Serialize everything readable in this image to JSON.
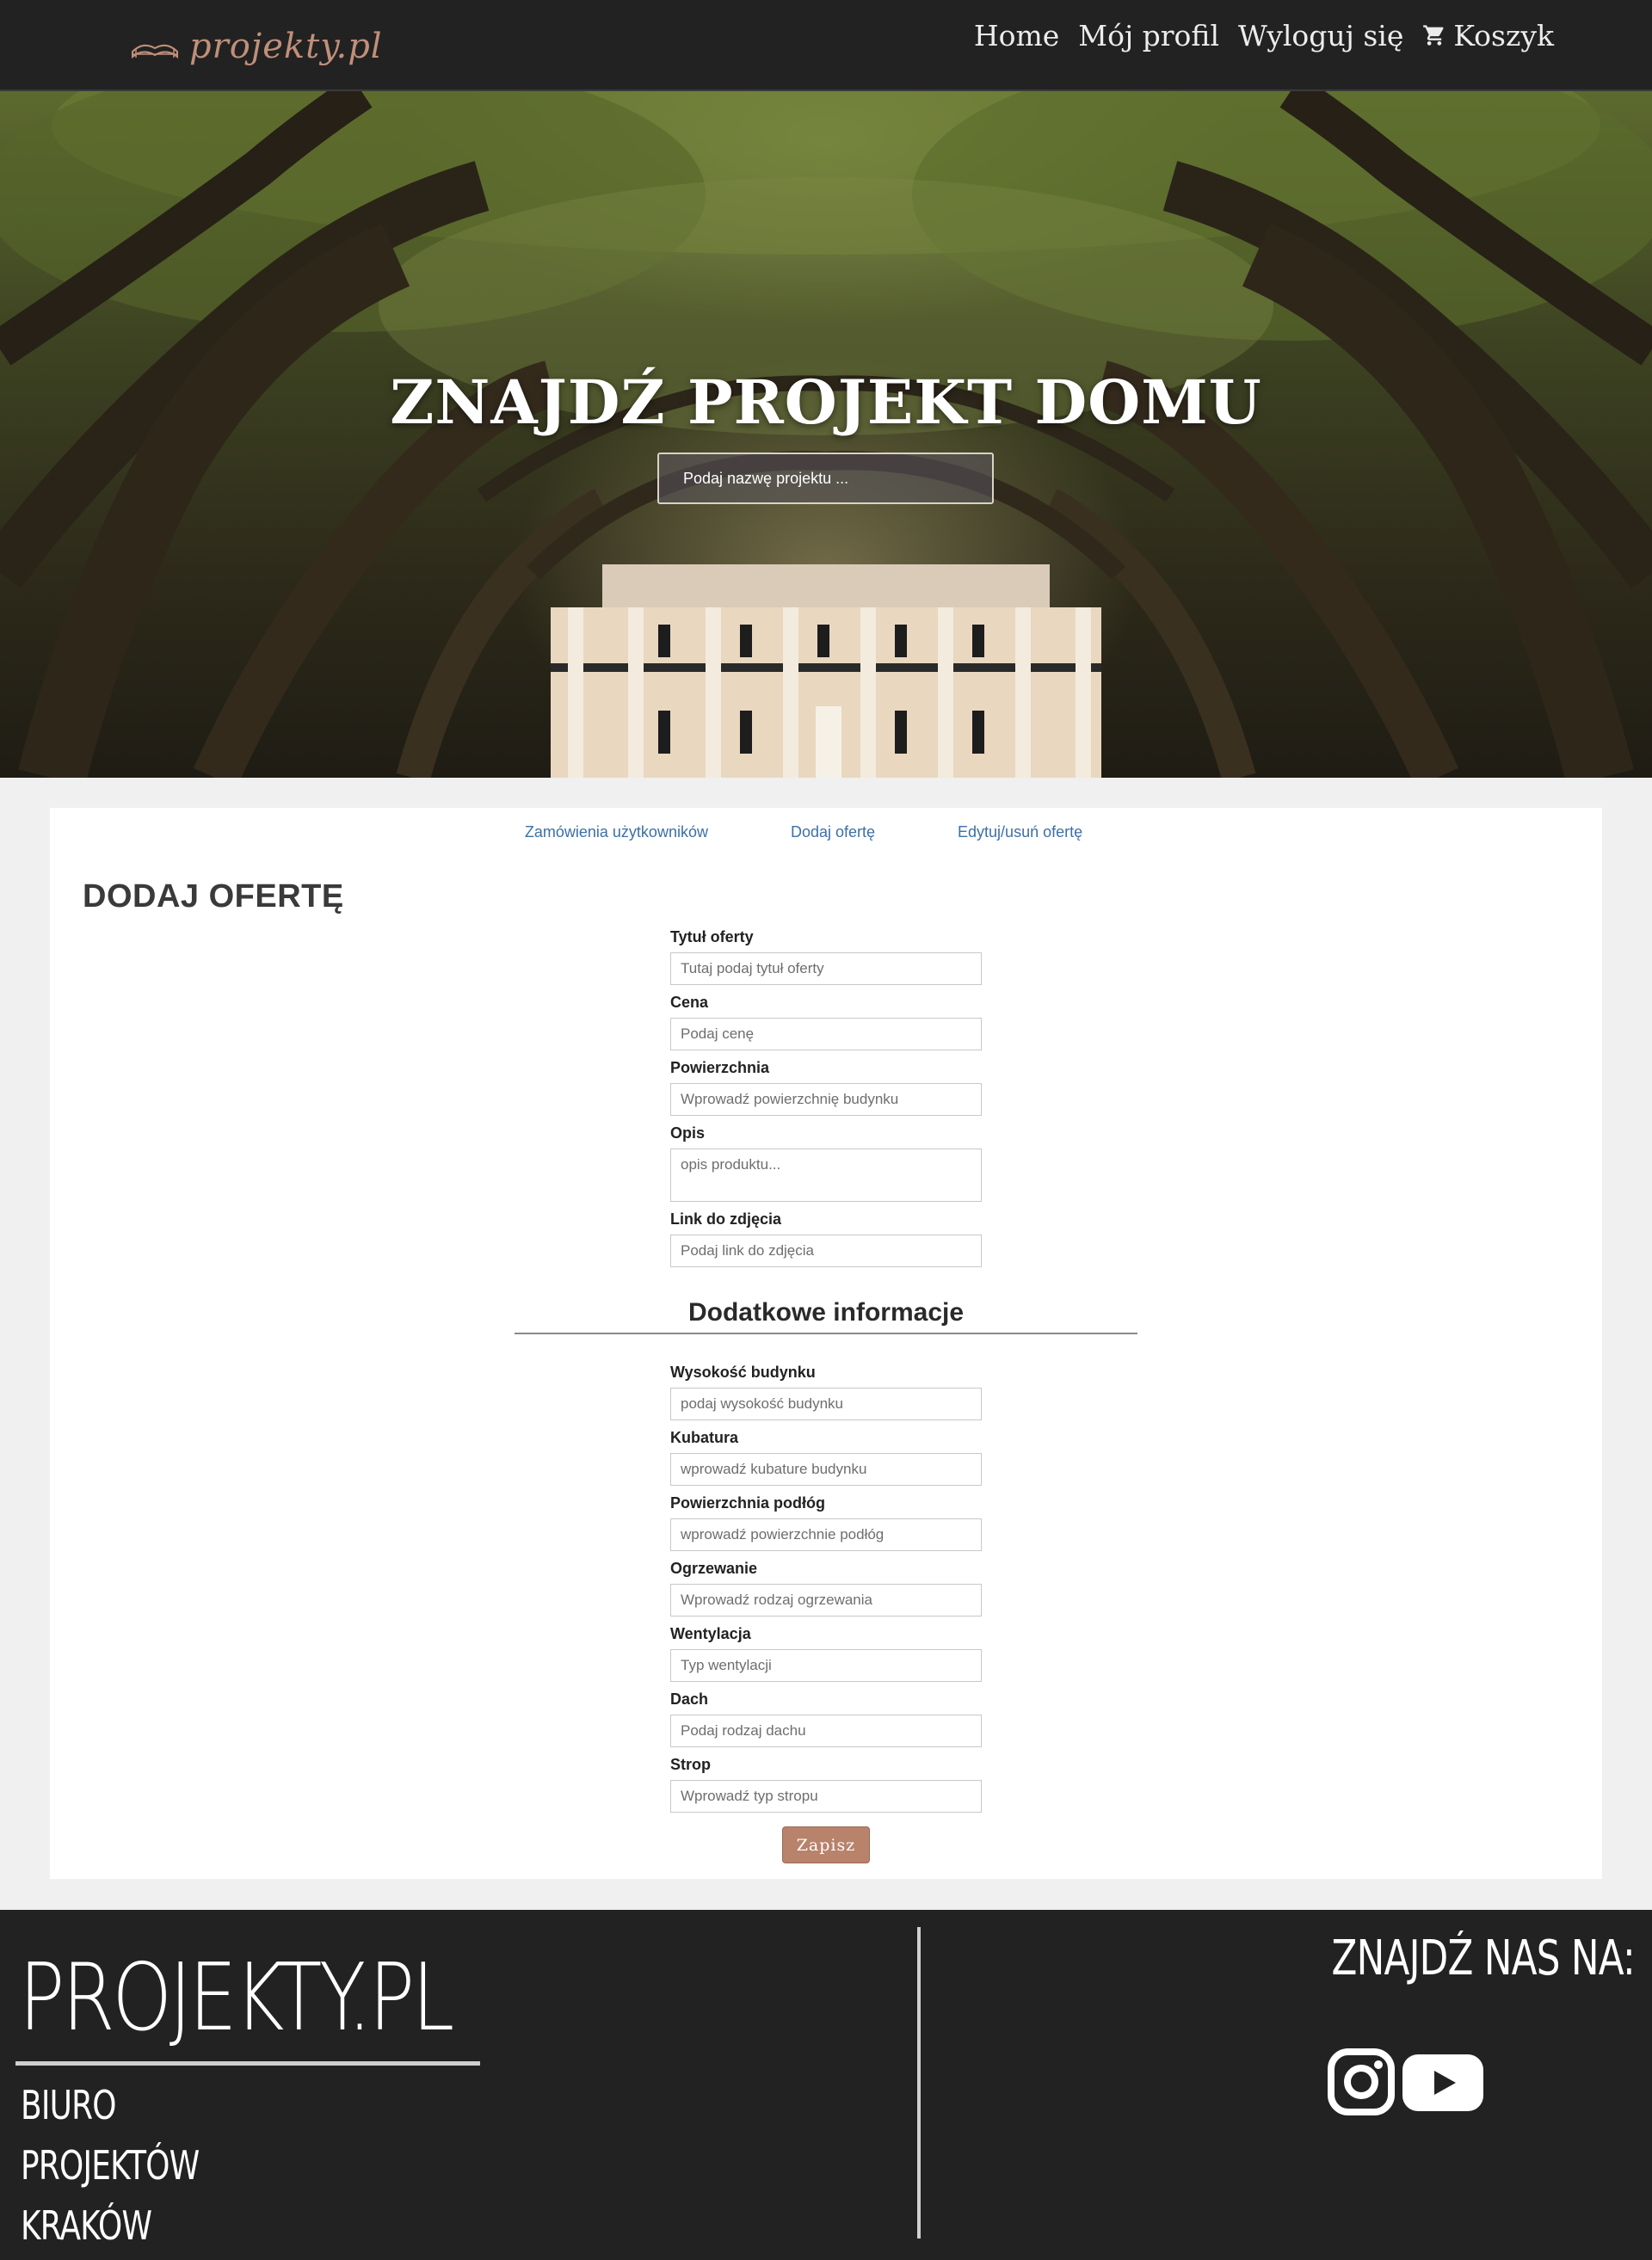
{
  "navbar": {
    "logo_text": "projekty.pl",
    "links": [
      {
        "label": "Home"
      },
      {
        "label": "Mój profil"
      },
      {
        "label": "Wyloguj się"
      },
      {
        "label": "Koszyk",
        "icon": "cart-icon"
      }
    ]
  },
  "hero": {
    "title": "ZNAJDŹ PROJEKT DOMU",
    "search_placeholder": "Podaj nazwę projektu ..."
  },
  "tabs": [
    {
      "label": "Zamówienia użytkowników"
    },
    {
      "label": "Dodaj ofertę"
    },
    {
      "label": "Edytuj/usuń ofertę"
    }
  ],
  "section_title": "DODAJ OFERTĘ",
  "form_main": [
    {
      "label": "Tytuł oferty",
      "placeholder": "Tutaj podaj tytuł oferty"
    },
    {
      "label": "Cena",
      "placeholder": "Podaj cenę"
    },
    {
      "label": "Powierzchnia",
      "placeholder": "Wprowadź powierzchnię budynku"
    },
    {
      "label": "Opis",
      "placeholder": "opis produktu..."
    },
    {
      "label": "Link do zdjęcia",
      "placeholder": "Podaj link do zdjęcia"
    }
  ],
  "extra_heading": "Dodatkowe informacje",
  "form_extra": [
    {
      "label": "Wysokość budynku",
      "placeholder": "podaj wysokość budynku"
    },
    {
      "label": "Kubatura",
      "placeholder": "wprowadź kubature budynku"
    },
    {
      "label": "Powierzchnia podłóg",
      "placeholder": "wprowadź powierzchnie podłóg"
    },
    {
      "label": "Ogrzewanie",
      "placeholder": "Wprowadź rodzaj ogrzewania"
    },
    {
      "label": "Wentylacja",
      "placeholder": "Typ wentylacji"
    },
    {
      "label": "Dach",
      "placeholder": "Podaj rodzaj dachu"
    },
    {
      "label": "Strop",
      "placeholder": "Wprowadź typ stropu"
    }
  ],
  "save_label": "Zapisz",
  "footer": {
    "brand": "PROJEKTY.PL",
    "lines": [
      "BIURO",
      "PROJEKTÓW",
      "KRAKÓW"
    ],
    "find_us": "ZNAJDŹ NAS NA:",
    "social": [
      "instagram-icon",
      "youtube-icon"
    ]
  },
  "colors": {
    "navbar_bg": "#222222",
    "accent": "#b8826b",
    "tab_link": "#3d6fa8",
    "footer_bg": "#222222"
  }
}
